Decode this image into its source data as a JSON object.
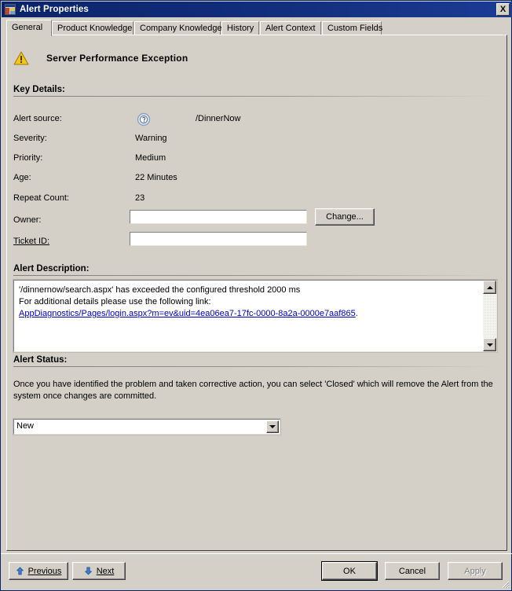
{
  "window": {
    "title": "Alert Properties",
    "icon": "properties-window-icon",
    "close_label": "X"
  },
  "tabs": [
    {
      "label": "General",
      "selected": true
    },
    {
      "label": "Product Knowledge",
      "selected": false
    },
    {
      "label": "Company Knowledge",
      "selected": false
    },
    {
      "label": "History",
      "selected": false
    },
    {
      "label": "Alert Context",
      "selected": false
    },
    {
      "label": "Custom Fields",
      "selected": false
    }
  ],
  "alert": {
    "severity_icon": "warning-triangle-icon",
    "title": "Server Performance Exception"
  },
  "key_details": {
    "heading": "Key Details:",
    "rows": [
      {
        "label": "Alert source:",
        "value": "/DinnerNow",
        "icon": "alert-source-icon"
      },
      {
        "label": "Severity:",
        "value": "Warning"
      },
      {
        "label": "Priority:",
        "value": "Medium"
      },
      {
        "label": "Age:",
        "value": "22 Minutes"
      },
      {
        "label": "Repeat Count:",
        "value": "23"
      }
    ],
    "owner": {
      "label": "Owner:",
      "value": "",
      "placeholder": ""
    },
    "ticket": {
      "label": "Ticket ID:",
      "value": "",
      "placeholder": ""
    },
    "change_button": "Change..."
  },
  "description": {
    "heading": "Alert Description:",
    "line1": "'/dinnernow/search.aspx' has exceeded the configured threshold 2000 ms",
    "line2": "For additional details please use the following link:",
    "link": "AppDiagnostics/Pages/login.aspx?m=ev&uid=4ea06ea7-17fc-0000-8a2a-0000e7aaf865",
    "link_suffix": "."
  },
  "status": {
    "heading": "Alert Status:",
    "description": "Once you have identified the problem and taken corrective action, you can select 'Closed' which will remove the Alert from the system once changes are committed.",
    "selected": "New",
    "options": [
      "New"
    ]
  },
  "footer": {
    "previous": "Previous",
    "next": "Next",
    "ok": "OK",
    "cancel": "Cancel",
    "apply": "Apply"
  },
  "colors": {
    "titlebar": "#0a246a",
    "face": "#d4d0c8",
    "link": "#0000c0",
    "warning": "#f0c419"
  }
}
